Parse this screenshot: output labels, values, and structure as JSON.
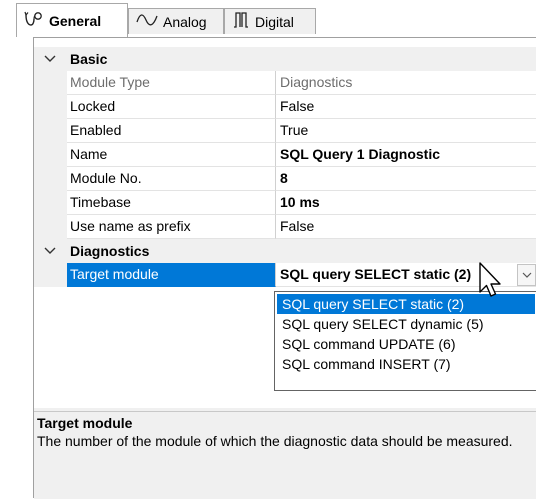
{
  "tabs": [
    {
      "label": "General",
      "icon": "general-icon",
      "active": true
    },
    {
      "label": "Analog",
      "icon": "analog-wave-icon",
      "active": false
    },
    {
      "label": "Digital",
      "icon": "digital-pulse-icon",
      "active": false
    }
  ],
  "categories": {
    "basic": "Basic",
    "diagnostics": "Diagnostics"
  },
  "properties": {
    "module_type": {
      "name": "Module Type",
      "value": "Diagnostics"
    },
    "locked": {
      "name": "Locked",
      "value": "False"
    },
    "enabled": {
      "name": "Enabled",
      "value": "True"
    },
    "name": {
      "name": "Name",
      "value": "SQL Query 1 Diagnostic"
    },
    "module_no": {
      "name": "Module No.",
      "value": "8"
    },
    "timebase": {
      "name": "Timebase",
      "value": "10 ms"
    },
    "use_name_as_prefix": {
      "name": "Use name as prefix",
      "value": "False"
    },
    "target_module": {
      "name": "Target module",
      "value": "SQL query SELECT static (2)"
    }
  },
  "dropdown": {
    "options": [
      "SQL query SELECT static (2)",
      "SQL query SELECT dynamic (5)",
      "SQL command UPDATE (6)",
      "SQL command INSERT (7)"
    ]
  },
  "description": {
    "title": "Target module",
    "text": "The number of the module of which the diagnostic data should be measured."
  },
  "colors": {
    "selection": "#0078d7",
    "category_bg": "#f0f0f0",
    "readonly_text": "#6d6d6d"
  }
}
